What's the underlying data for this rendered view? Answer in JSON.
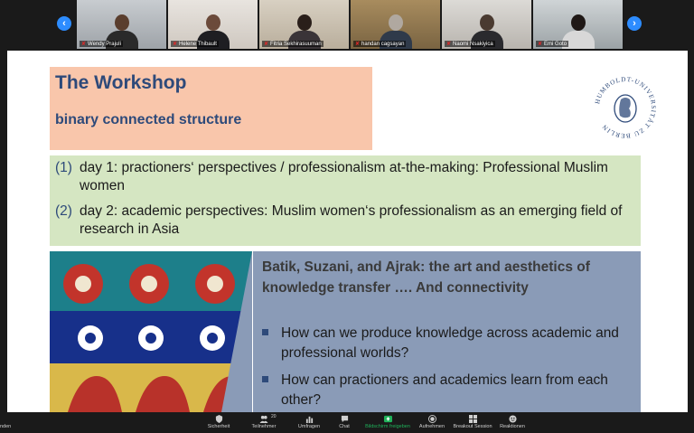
{
  "gallery": {
    "participants": [
      {
        "name": "Wendy Prajuli",
        "muted": true
      },
      {
        "name": "Helene Thibault",
        "muted": true
      },
      {
        "name": "Fitria Sekhirasuuman",
        "muted": true
      },
      {
        "name": "handan cagsayan",
        "muted": true
      },
      {
        "name": "Naomi Nsakiyica",
        "muted": true
      },
      {
        "name": "Emi Goto",
        "muted": true
      }
    ],
    "prev_label": "‹",
    "next_label": "›"
  },
  "slide": {
    "title": "The Workshop",
    "subtitle": "binary connected structure",
    "logo_text": "HUMBOLDT-UNIVERSITÄT ZU BERLIN",
    "list": [
      {
        "num": "(1)",
        "text": "day 1: practioners‘ perspectives / professionalism at-the-making: Professional Muslim women"
      },
      {
        "num": "(2)",
        "text": "day 2: academic perspectives: Muslim women‘s professionalism as an emerging field of research in Asia"
      }
    ],
    "right_heading": "Batik, Suzani, and Ajrak: the art and aesthetics of knowledge transfer …. And connectivity",
    "bullets": [
      "How can we produce knowledge across academic and professional worlds?",
      "How can practioners and academics learn from each other?"
    ]
  },
  "toolbar": {
    "end_label": "nden",
    "items": [
      {
        "label": "Sicherheit",
        "icon": "shield-icon"
      },
      {
        "label": "Teilnehmer",
        "icon": "participants-icon",
        "badge": "20"
      },
      {
        "label": "Umfragen",
        "icon": "polls-icon"
      },
      {
        "label": "Chat",
        "icon": "chat-icon"
      },
      {
        "label": "Bildschirm freigeben",
        "icon": "share-screen-icon"
      },
      {
        "label": "Aufnehmen",
        "icon": "record-icon"
      },
      {
        "label": "Breakout Session",
        "icon": "breakout-icon"
      },
      {
        "label": "Reaktionen",
        "icon": "reactions-icon"
      }
    ]
  },
  "colors": {
    "accent": "#2d8cff",
    "share_green": "#20b15a",
    "title_blue": "#2e4a7a",
    "salmon": "#f9c6ab",
    "green_box": "#d5e6c2",
    "slate_box": "#8a9bb7"
  }
}
